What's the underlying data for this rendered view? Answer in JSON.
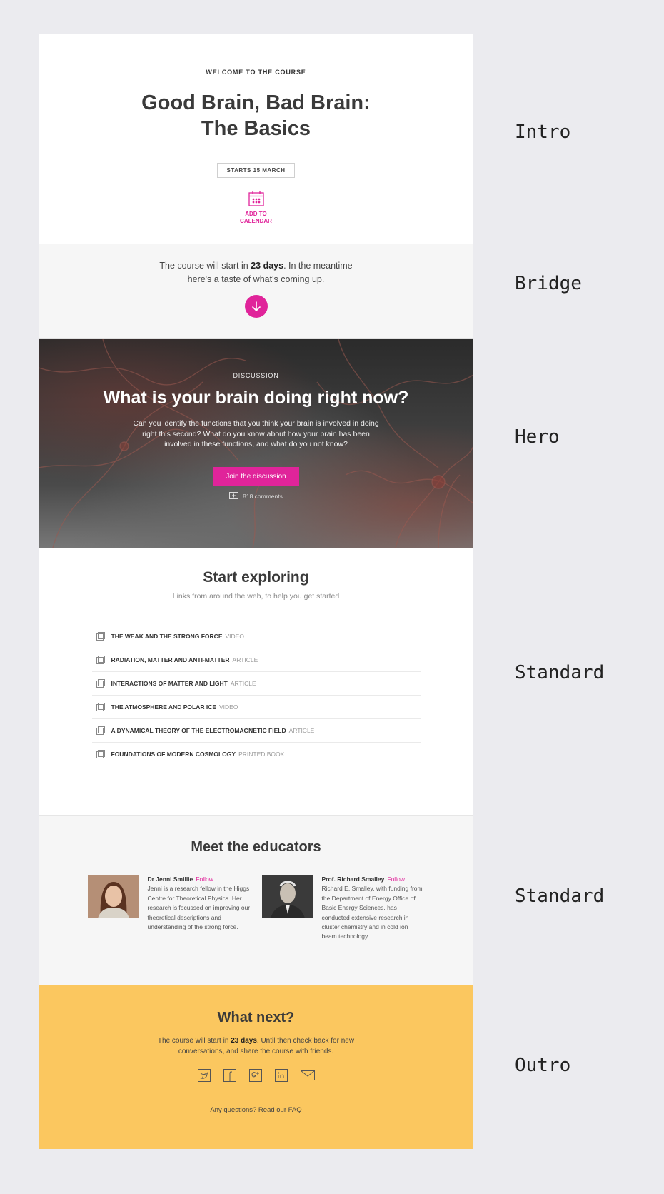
{
  "intro": {
    "eyebrow": "WELCOME TO THE COURSE",
    "title_line1": "Good Brain, Bad Brain:",
    "title_line2": "The Basics",
    "starts": "STARTS 15 MARCH",
    "calendar_line1": "ADD TO",
    "calendar_line2": "CALENDAR",
    "calendar_icon": "calendar-icon"
  },
  "bridge": {
    "text_before": "The course will start in ",
    "days": "23 days",
    "text_after": ". In the meantime here's a taste of what's coming up.",
    "arrow_icon": "arrow-down-icon"
  },
  "hero": {
    "eyebrow": "DISCUSSION",
    "title": "What is your brain doing right now?",
    "body": "Can you identify the functions that you think your brain is involved in doing right this second? What do you know about how your brain has been involved in these functions, and what do you not know?",
    "button": "Join the discussion",
    "comments": "818 comments"
  },
  "explore": {
    "title": "Start exploring",
    "subtitle": "Links from around the web, to help you get started",
    "links": [
      {
        "title": "THE WEAK AND THE STRONG FORCE",
        "kind": "VIDEO"
      },
      {
        "title": "RADIATION, MATTER AND ANTI-MATTER",
        "kind": "ARTICLE"
      },
      {
        "title": "INTERACTIONS OF MATTER AND LIGHT",
        "kind": "ARTICLE"
      },
      {
        "title": "THE ATMOSPHERE AND POLAR ICE",
        "kind": "VIDEO"
      },
      {
        "title": "A DYNAMICAL THEORY OF THE ELECTROMAGNETIC FIELD",
        "kind": "ARTICLE"
      },
      {
        "title": "FOUNDATIONS OF MODERN COSMOLOGY",
        "kind": "PRINTED BOOK"
      }
    ]
  },
  "educators": {
    "title": "Meet the educators",
    "people": [
      {
        "name": "Dr Jenni Smillie",
        "follow": "Follow",
        "bio": "Jenni is a research fellow in the Higgs Centre for Theoretical Physics. Her research is focussed on improving our theoretical descriptions and understanding of the strong force."
      },
      {
        "name": "Prof. Richard Smalley",
        "follow": "Follow",
        "bio": "Richard E. Smalley, with funding from the Department of Energy Office of Basic Energy Sciences, has conducted extensive research in cluster chemistry and in cold ion beam technology."
      }
    ]
  },
  "outro": {
    "title": "What next?",
    "text_before": "The course will start in ",
    "days": "23 days",
    "text_after": ". Until then check back for new conversations, and share the course with friends.",
    "socials": [
      "twitter-icon",
      "facebook-icon",
      "google-plus-icon",
      "linkedin-icon",
      "email-icon"
    ],
    "faq": "Any questions? Read our FAQ"
  },
  "labels": [
    "Intro",
    "Bridge",
    "Hero",
    "Standard",
    "Standard",
    "Outro"
  ],
  "colors": {
    "accent": "#e0249a",
    "outro_bg": "#fbc75f",
    "page_bg": "#ebebef"
  }
}
